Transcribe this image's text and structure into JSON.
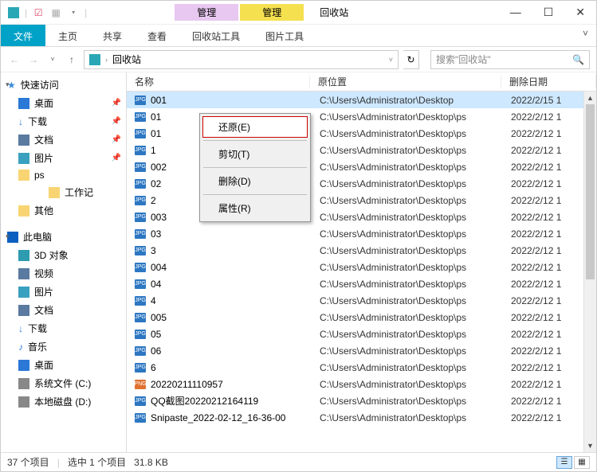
{
  "window": {
    "title": "回收站"
  },
  "context_tabs": [
    {
      "label": "管理",
      "sub": "回收站工具"
    },
    {
      "label": "管理",
      "sub": "图片工具"
    }
  ],
  "ribbon": {
    "file": "文件",
    "home": "主页",
    "share": "共享",
    "view": "查看",
    "t1": "回收站工具",
    "t2": "图片工具"
  },
  "address": {
    "location": "回收站",
    "search_placeholder": "搜索\"回收站\""
  },
  "sidebar": {
    "quick": "快速访问",
    "desktop": "桌面",
    "downloads": "下载",
    "documents": "文档",
    "pictures": "图片",
    "ps": "ps",
    "work": "工作记",
    "other": "其他",
    "thispc": "此电脑",
    "obj3d": "3D 对象",
    "video": "视频",
    "pictures2": "图片",
    "docs2": "文档",
    "downloads2": "下载",
    "music": "音乐",
    "desktop2": "桌面",
    "sysdrive": "系统文件 (C:)",
    "localdisk": "本地磁盘 (D:)"
  },
  "columns": {
    "name": "名称",
    "loc": "原位置",
    "date": "删除日期"
  },
  "files": [
    {
      "ico": "JPG",
      "name": "001",
      "loc": "C:\\Users\\Administrator\\Desktop",
      "date": "2022/2/15 1",
      "sel": true
    },
    {
      "ico": "JPG",
      "name": "01",
      "loc": "C:\\Users\\Administrator\\Desktop\\ps",
      "date": "2022/2/12 1"
    },
    {
      "ico": "JPG",
      "name": "01",
      "loc": "C:\\Users\\Administrator\\Desktop\\ps",
      "date": "2022/2/12 1"
    },
    {
      "ico": "JPG",
      "name": "1",
      "loc": "C:\\Users\\Administrator\\Desktop\\ps",
      "date": "2022/2/12 1"
    },
    {
      "ico": "JPG",
      "name": "002",
      "loc": "C:\\Users\\Administrator\\Desktop\\ps",
      "date": "2022/2/12 1"
    },
    {
      "ico": "JPG",
      "name": "02",
      "loc": "C:\\Users\\Administrator\\Desktop\\ps",
      "date": "2022/2/12 1"
    },
    {
      "ico": "JPG",
      "name": "2",
      "loc": "C:\\Users\\Administrator\\Desktop\\ps",
      "date": "2022/2/12 1"
    },
    {
      "ico": "JPG",
      "name": "003",
      "loc": "C:\\Users\\Administrator\\Desktop\\ps",
      "date": "2022/2/12 1"
    },
    {
      "ico": "JPG",
      "name": "03",
      "loc": "C:\\Users\\Administrator\\Desktop\\ps",
      "date": "2022/2/12 1"
    },
    {
      "ico": "JPG",
      "name": "3",
      "loc": "C:\\Users\\Administrator\\Desktop\\ps",
      "date": "2022/2/12 1"
    },
    {
      "ico": "JPG",
      "name": "004",
      "loc": "C:\\Users\\Administrator\\Desktop\\ps",
      "date": "2022/2/12 1"
    },
    {
      "ico": "JPG",
      "name": "04",
      "loc": "C:\\Users\\Administrator\\Desktop\\ps",
      "date": "2022/2/12 1"
    },
    {
      "ico": "JPG",
      "name": "4",
      "loc": "C:\\Users\\Administrator\\Desktop\\ps",
      "date": "2022/2/12 1"
    },
    {
      "ico": "JPG",
      "name": "005",
      "loc": "C:\\Users\\Administrator\\Desktop\\ps",
      "date": "2022/2/12 1"
    },
    {
      "ico": "JPG",
      "name": "05",
      "loc": "C:\\Users\\Administrator\\Desktop\\ps",
      "date": "2022/2/12 1"
    },
    {
      "ico": "JPG",
      "name": "06",
      "loc": "C:\\Users\\Administrator\\Desktop\\ps",
      "date": "2022/2/12 1"
    },
    {
      "ico": "JPG",
      "name": "6",
      "loc": "C:\\Users\\Administrator\\Desktop\\ps",
      "date": "2022/2/12 1"
    },
    {
      "ico": "PNG",
      "name": "20220211110957",
      "loc": "C:\\Users\\Administrator\\Desktop\\ps",
      "date": "2022/2/12 1",
      "png": true
    },
    {
      "ico": "JPG",
      "name": "QQ截图20220212164119",
      "loc": "C:\\Users\\Administrator\\Desktop\\ps",
      "date": "2022/2/12 1"
    },
    {
      "ico": "JPG",
      "name": "Snipaste_2022-02-12_16-36-00",
      "loc": "C:\\Users\\Administrator\\Desktop\\ps",
      "date": "2022/2/12 1"
    }
  ],
  "context_menu": {
    "restore": "还原(E)",
    "cut": "剪切(T)",
    "delete": "删除(D)",
    "properties": "属性(R)"
  },
  "status": {
    "count": "37 个项目",
    "selected": "选中 1 个项目",
    "size": "31.8 KB"
  }
}
